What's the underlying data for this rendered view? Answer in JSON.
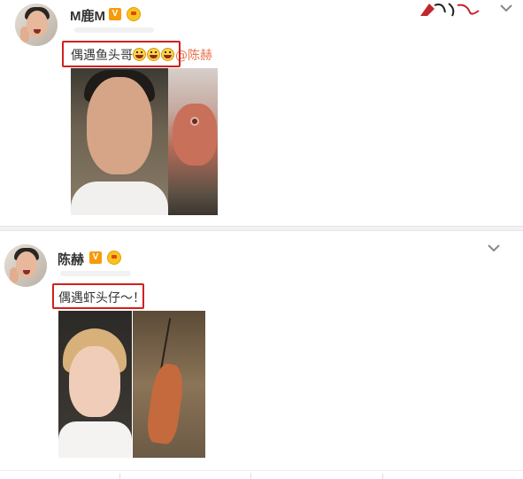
{
  "posts": [
    {
      "username": "M鹿M",
      "verified_badge": "V",
      "text": "偶遇鱼头哥",
      "emojis": [
        "grin-emoji",
        "grin-emoji",
        "grin-emoji"
      ],
      "mention": "@陈赫",
      "images": [
        "man-selfie-photo",
        "fish-head-photo"
      ]
    },
    {
      "username": "陈赫",
      "verified_badge": "V",
      "text": "偶遇虾头仔～！",
      "images": [
        "blond-man-selfie-photo",
        "shrimp-photo"
      ]
    }
  ],
  "colors": {
    "highlight_box": "#d2201e",
    "mention": "#eb7350",
    "verified_badge": "#f79b0a",
    "divider": "#f2f2f5"
  },
  "icons": [
    "chevron-down-icon",
    "verified-icon",
    "crown-badge-icon",
    "brand-logo"
  ]
}
